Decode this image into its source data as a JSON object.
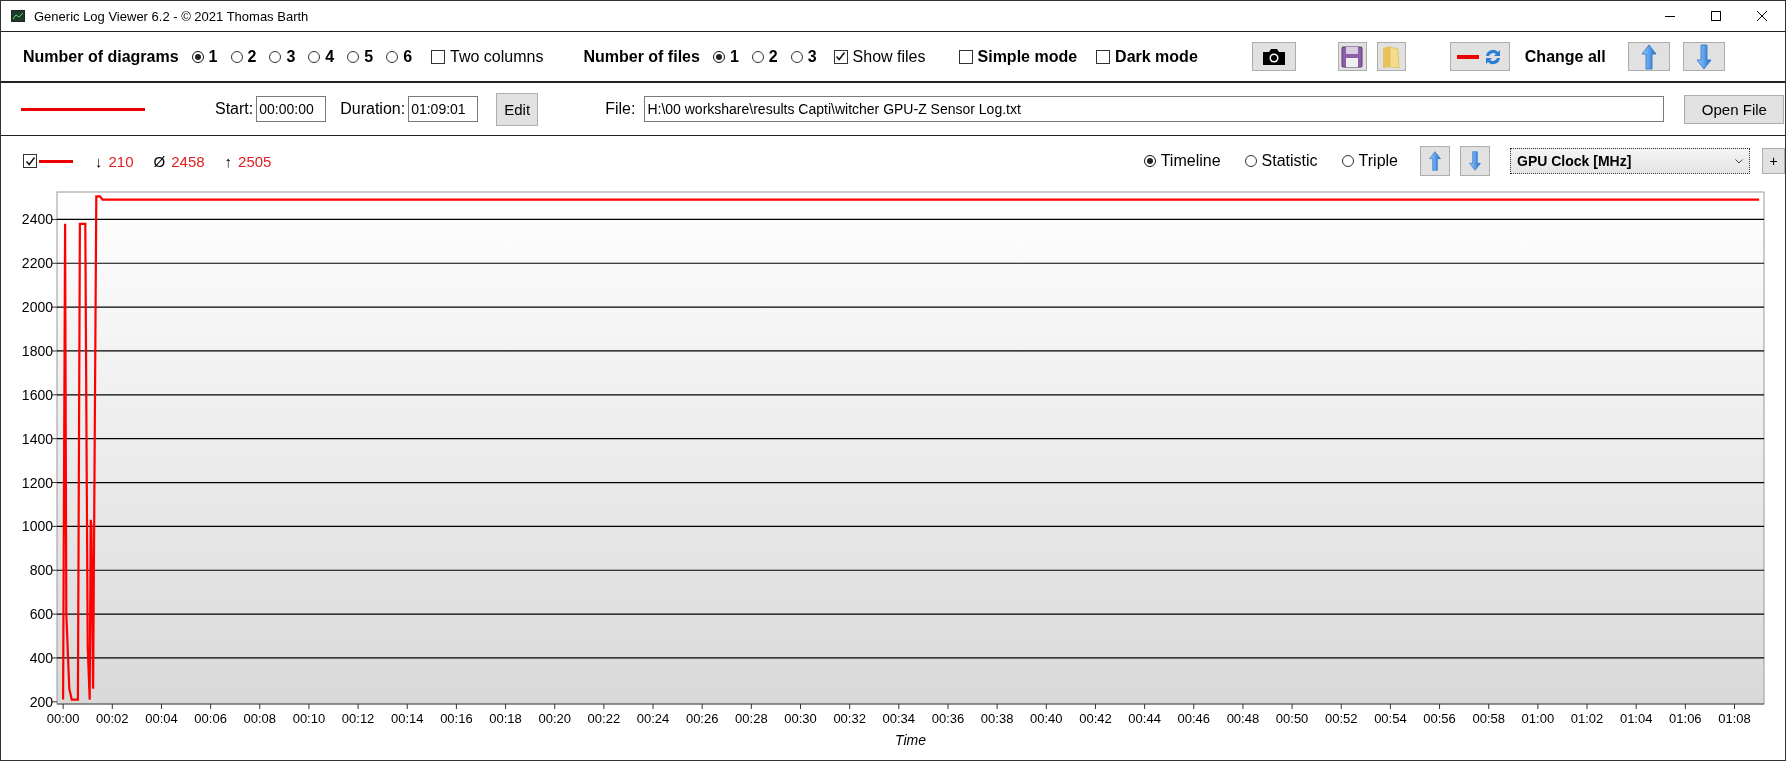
{
  "window": {
    "title": "Generic Log Viewer 6.2 - © 2021 Thomas Barth"
  },
  "toolbar": {
    "diagrams_label": "Number of diagrams",
    "diagram_options": [
      {
        "label": "1",
        "selected": true
      },
      {
        "label": "2",
        "selected": false
      },
      {
        "label": "3",
        "selected": false
      },
      {
        "label": "4",
        "selected": false
      },
      {
        "label": "5",
        "selected": false
      },
      {
        "label": "6",
        "selected": false
      }
    ],
    "two_columns": {
      "label": "Two columns",
      "checked": false
    },
    "files_label": "Number of files",
    "file_options": [
      {
        "label": "1",
        "selected": true
      },
      {
        "label": "2",
        "selected": false
      },
      {
        "label": "3",
        "selected": false
      }
    ],
    "show_files": {
      "label": "Show files",
      "checked": true
    },
    "simple_mode": {
      "label": "Simple mode",
      "checked": false
    },
    "dark_mode": {
      "label": "Dark mode",
      "checked": false
    },
    "change_all_label": "Change all"
  },
  "file_row": {
    "start_label": "Start:",
    "start_value": "00:00:00",
    "duration_label": "Duration:",
    "duration_value": "01:09:01",
    "edit_button": "Edit",
    "file_label": "File:",
    "file_value": "H:\\00 workshare\\results Capti\\witcher GPU-Z Sensor Log.txt",
    "open_button": "Open File"
  },
  "diagram": {
    "visible": {
      "checked": true
    },
    "min_symbol": "↓",
    "min": "210",
    "avg_symbol": "Ø",
    "avg": "2458",
    "max_symbol": "↑",
    "max": "2505",
    "modes": [
      {
        "label": "Timeline",
        "selected": true
      },
      {
        "label": "Statistic",
        "selected": false
      },
      {
        "label": "Triple",
        "selected": false
      }
    ],
    "channel": "GPU Clock [MHz]",
    "add_button": "+",
    "chart_data": {
      "type": "line",
      "xlabel": "Time",
      "x": [
        0,
        0.08,
        0.13,
        0.25,
        0.35,
        0.6,
        0.68,
        0.75,
        0.9,
        1.0,
        1.08,
        1.12,
        1.15,
        1.22,
        1.35,
        1.5,
        1.6,
        69.0
      ],
      "grid": true,
      "series": [
        {
          "color": "#ff0000",
          "values": [
            210,
            2380,
            600,
            260,
            210,
            210,
            2380,
            2380,
            2380,
            450,
            210,
            1030,
            1000,
            260,
            2505,
            2505,
            2490,
            2490
          ]
        }
      ],
      "xlim": [
        -0.25,
        69.2
      ],
      "ylim": [
        190,
        2525
      ],
      "xticks": [
        {
          "value": 0,
          "label": "00:00"
        },
        {
          "value": 2,
          "label": "00:02"
        },
        {
          "value": 4,
          "label": "00:04"
        },
        {
          "value": 6,
          "label": "00:06"
        },
        {
          "value": 8,
          "label": "00:08"
        },
        {
          "value": 10,
          "label": "00:10"
        },
        {
          "value": 12,
          "label": "00:12"
        },
        {
          "value": 14,
          "label": "00:14"
        },
        {
          "value": 16,
          "label": "00:16"
        },
        {
          "value": 18,
          "label": "00:18"
        },
        {
          "value": 20,
          "label": "00:20"
        },
        {
          "value": 22,
          "label": "00:22"
        },
        {
          "value": 24,
          "label": "00:24"
        },
        {
          "value": 26,
          "label": "00:26"
        },
        {
          "value": 28,
          "label": "00:28"
        },
        {
          "value": 30,
          "label": "00:30"
        },
        {
          "value": 32,
          "label": "00:32"
        },
        {
          "value": 34,
          "label": "00:34"
        },
        {
          "value": 36,
          "label": "00:36"
        },
        {
          "value": 38,
          "label": "00:38"
        },
        {
          "value": 40,
          "label": "00:40"
        },
        {
          "value": 42,
          "label": "00:42"
        },
        {
          "value": 44,
          "label": "00:44"
        },
        {
          "value": 46,
          "label": "00:46"
        },
        {
          "value": 48,
          "label": "00:48"
        },
        {
          "value": 50,
          "label": "00:50"
        },
        {
          "value": 52,
          "label": "00:52"
        },
        {
          "value": 54,
          "label": "00:54"
        },
        {
          "value": 56,
          "label": "00:56"
        },
        {
          "value": 58,
          "label": "00:58"
        },
        {
          "value": 60,
          "label": "01:00"
        },
        {
          "value": 62,
          "label": "01:02"
        },
        {
          "value": 64,
          "label": "01:04"
        },
        {
          "value": 66,
          "label": "01:06"
        },
        {
          "value": 68,
          "label": "01:08"
        }
      ],
      "yticks": [
        200,
        400,
        600,
        800,
        1000,
        1200,
        1400,
        1600,
        1800,
        2000,
        2200,
        2400
      ]
    }
  }
}
